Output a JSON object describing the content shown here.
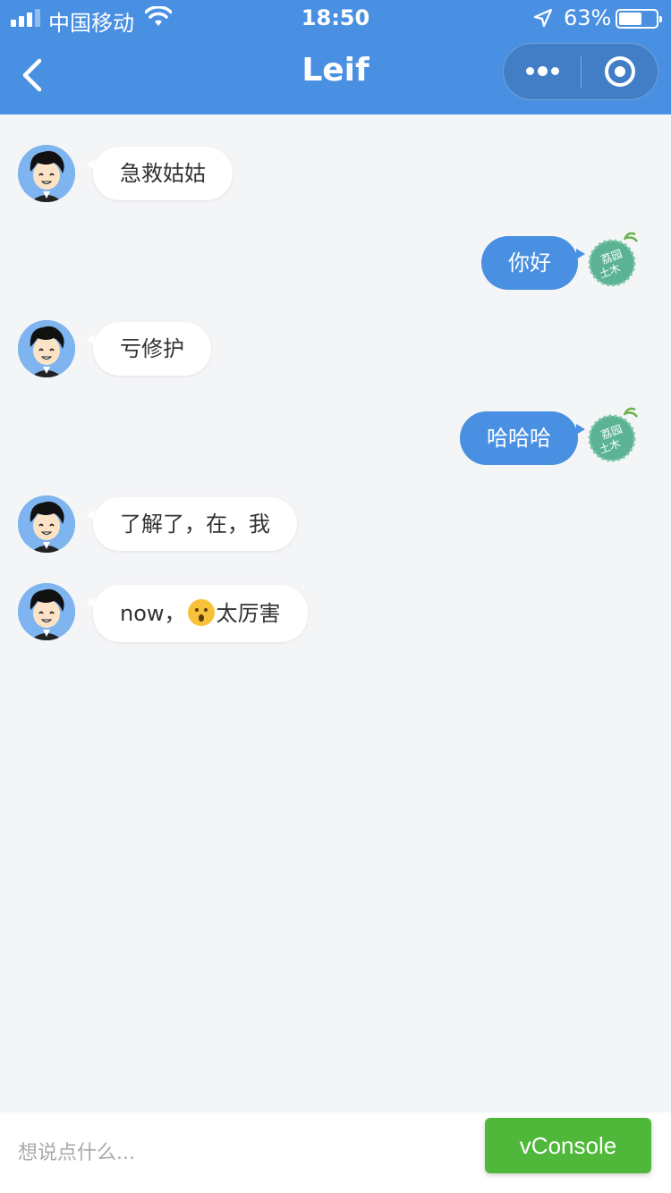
{
  "status_bar": {
    "carrier": "中国移动",
    "time": "18:50",
    "battery_percent": "63%",
    "battery_level": 0.63,
    "signal_bars_filled": 3,
    "signal_bars_total": 4
  },
  "nav": {
    "title": "Leif",
    "back_icon": "chevron-left-icon",
    "more_icon": "more-dots-icon",
    "close_icon": "target-circle-icon"
  },
  "messages": [
    {
      "side": "left",
      "text": "急救姑姑"
    },
    {
      "side": "right",
      "text": "你好"
    },
    {
      "side": "left",
      "text": "亏修护"
    },
    {
      "side": "right",
      "text": "哈哈哈"
    },
    {
      "side": "left",
      "text": "了解了，在，我"
    },
    {
      "side": "left",
      "text_before": "now，",
      "emoji": "hushed-face-emoji",
      "text_after": "太厉害"
    }
  ],
  "self_avatar_text": [
    "荔园",
    "土木"
  ],
  "input": {
    "placeholder": "想说点什么..."
  },
  "vconsole": {
    "label": "vConsole"
  },
  "colors": {
    "header_bg": "#4a90e2",
    "outgoing_bubble": "#4a90e2",
    "incoming_bubble": "#ffffff",
    "page_bg": "#f4f5f7",
    "vconsole_bg": "#4fb83a"
  }
}
